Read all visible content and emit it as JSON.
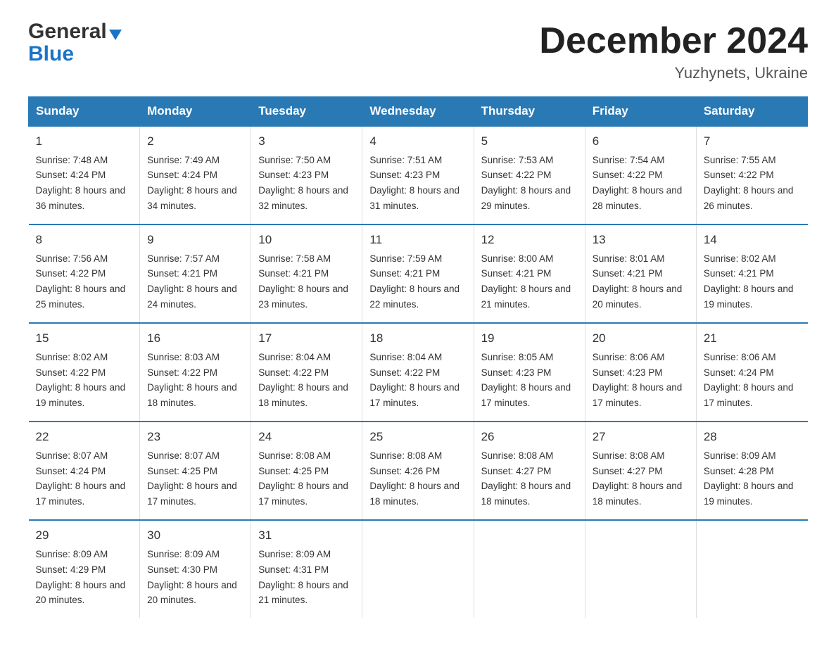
{
  "logo": {
    "general": "General",
    "blue": "Blue"
  },
  "title": "December 2024",
  "location": "Yuzhynets, Ukraine",
  "days_of_week": [
    "Sunday",
    "Monday",
    "Tuesday",
    "Wednesday",
    "Thursday",
    "Friday",
    "Saturday"
  ],
  "weeks": [
    [
      {
        "day": "1",
        "sunrise": "7:48 AM",
        "sunset": "4:24 PM",
        "daylight": "8 hours and 36 minutes."
      },
      {
        "day": "2",
        "sunrise": "7:49 AM",
        "sunset": "4:24 PM",
        "daylight": "8 hours and 34 minutes."
      },
      {
        "day": "3",
        "sunrise": "7:50 AM",
        "sunset": "4:23 PM",
        "daylight": "8 hours and 32 minutes."
      },
      {
        "day": "4",
        "sunrise": "7:51 AM",
        "sunset": "4:23 PM",
        "daylight": "8 hours and 31 minutes."
      },
      {
        "day": "5",
        "sunrise": "7:53 AM",
        "sunset": "4:22 PM",
        "daylight": "8 hours and 29 minutes."
      },
      {
        "day": "6",
        "sunrise": "7:54 AM",
        "sunset": "4:22 PM",
        "daylight": "8 hours and 28 minutes."
      },
      {
        "day": "7",
        "sunrise": "7:55 AM",
        "sunset": "4:22 PM",
        "daylight": "8 hours and 26 minutes."
      }
    ],
    [
      {
        "day": "8",
        "sunrise": "7:56 AM",
        "sunset": "4:22 PM",
        "daylight": "8 hours and 25 minutes."
      },
      {
        "day": "9",
        "sunrise": "7:57 AM",
        "sunset": "4:21 PM",
        "daylight": "8 hours and 24 minutes."
      },
      {
        "day": "10",
        "sunrise": "7:58 AM",
        "sunset": "4:21 PM",
        "daylight": "8 hours and 23 minutes."
      },
      {
        "day": "11",
        "sunrise": "7:59 AM",
        "sunset": "4:21 PM",
        "daylight": "8 hours and 22 minutes."
      },
      {
        "day": "12",
        "sunrise": "8:00 AM",
        "sunset": "4:21 PM",
        "daylight": "8 hours and 21 minutes."
      },
      {
        "day": "13",
        "sunrise": "8:01 AM",
        "sunset": "4:21 PM",
        "daylight": "8 hours and 20 minutes."
      },
      {
        "day": "14",
        "sunrise": "8:02 AM",
        "sunset": "4:21 PM",
        "daylight": "8 hours and 19 minutes."
      }
    ],
    [
      {
        "day": "15",
        "sunrise": "8:02 AM",
        "sunset": "4:22 PM",
        "daylight": "8 hours and 19 minutes."
      },
      {
        "day": "16",
        "sunrise": "8:03 AM",
        "sunset": "4:22 PM",
        "daylight": "8 hours and 18 minutes."
      },
      {
        "day": "17",
        "sunrise": "8:04 AM",
        "sunset": "4:22 PM",
        "daylight": "8 hours and 18 minutes."
      },
      {
        "day": "18",
        "sunrise": "8:04 AM",
        "sunset": "4:22 PM",
        "daylight": "8 hours and 17 minutes."
      },
      {
        "day": "19",
        "sunrise": "8:05 AM",
        "sunset": "4:23 PM",
        "daylight": "8 hours and 17 minutes."
      },
      {
        "day": "20",
        "sunrise": "8:06 AM",
        "sunset": "4:23 PM",
        "daylight": "8 hours and 17 minutes."
      },
      {
        "day": "21",
        "sunrise": "8:06 AM",
        "sunset": "4:24 PM",
        "daylight": "8 hours and 17 minutes."
      }
    ],
    [
      {
        "day": "22",
        "sunrise": "8:07 AM",
        "sunset": "4:24 PM",
        "daylight": "8 hours and 17 minutes."
      },
      {
        "day": "23",
        "sunrise": "8:07 AM",
        "sunset": "4:25 PM",
        "daylight": "8 hours and 17 minutes."
      },
      {
        "day": "24",
        "sunrise": "8:08 AM",
        "sunset": "4:25 PM",
        "daylight": "8 hours and 17 minutes."
      },
      {
        "day": "25",
        "sunrise": "8:08 AM",
        "sunset": "4:26 PM",
        "daylight": "8 hours and 18 minutes."
      },
      {
        "day": "26",
        "sunrise": "8:08 AM",
        "sunset": "4:27 PM",
        "daylight": "8 hours and 18 minutes."
      },
      {
        "day": "27",
        "sunrise": "8:08 AM",
        "sunset": "4:27 PM",
        "daylight": "8 hours and 18 minutes."
      },
      {
        "day": "28",
        "sunrise": "8:09 AM",
        "sunset": "4:28 PM",
        "daylight": "8 hours and 19 minutes."
      }
    ],
    [
      {
        "day": "29",
        "sunrise": "8:09 AM",
        "sunset": "4:29 PM",
        "daylight": "8 hours and 20 minutes."
      },
      {
        "day": "30",
        "sunrise": "8:09 AM",
        "sunset": "4:30 PM",
        "daylight": "8 hours and 20 minutes."
      },
      {
        "day": "31",
        "sunrise": "8:09 AM",
        "sunset": "4:31 PM",
        "daylight": "8 hours and 21 minutes."
      },
      null,
      null,
      null,
      null
    ]
  ]
}
